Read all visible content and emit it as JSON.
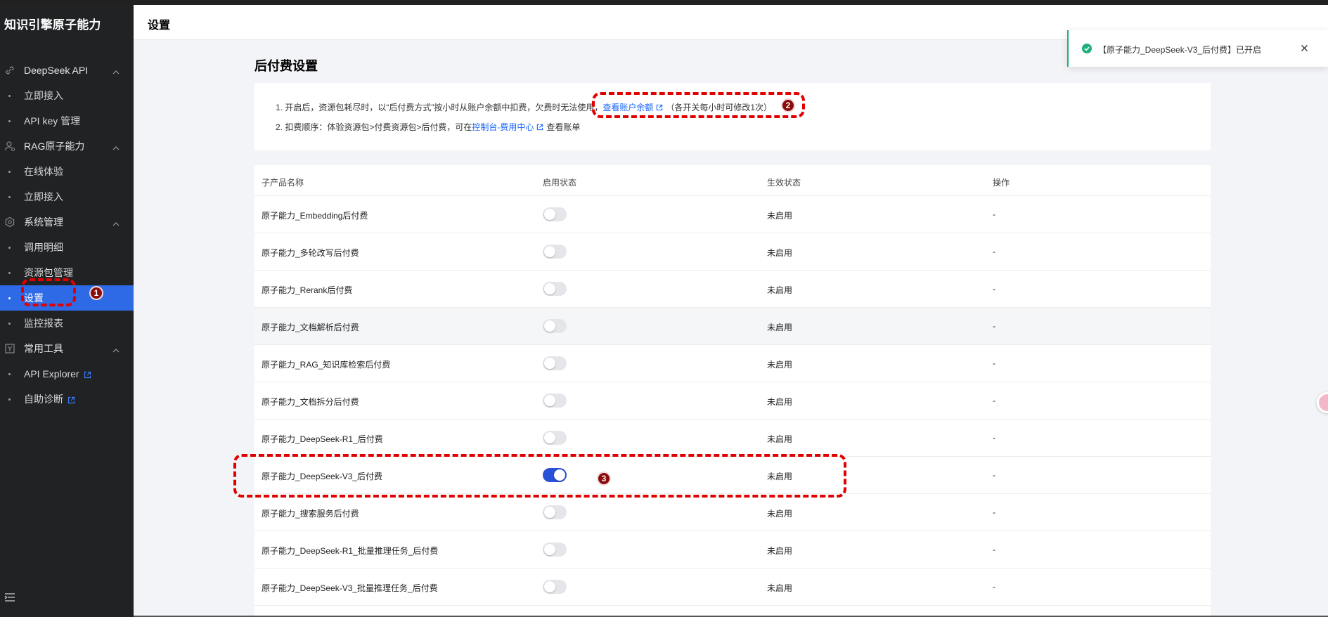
{
  "app": {
    "title": "知识引擎原子能力"
  },
  "sidebar": {
    "groups": [
      {
        "label": "DeepSeek API",
        "icon": "link-icon",
        "items": [
          {
            "label": "立即接入"
          },
          {
            "label": "API key 管理"
          }
        ]
      },
      {
        "label": "RAG原子能力",
        "icon": "user-gear-icon",
        "items": [
          {
            "label": "在线体验"
          },
          {
            "label": "立即接入"
          }
        ]
      },
      {
        "label": "系统管理",
        "icon": "settings-icon",
        "items": [
          {
            "label": "调用明细"
          },
          {
            "label": "资源包管理"
          },
          {
            "label": "设置",
            "active": true
          },
          {
            "label": "监控报表"
          }
        ]
      },
      {
        "label": "常用工具",
        "icon": "tools-icon",
        "items": [
          {
            "label": "API Explorer",
            "external": true
          },
          {
            "label": "自助诊断",
            "external": true
          }
        ]
      }
    ]
  },
  "header": {
    "title": "设置"
  },
  "section": {
    "title": "后付费设置"
  },
  "notice": {
    "line1_prefix": "1. 开启后，资源包耗尽时，以“后付费方式”按小时从账户余额中扣费，欠费时无法使用，",
    "line1_link": "查看账户余额",
    "line1_suffix": "（各开关每小时可修改1次）",
    "line2_prefix": "2. 扣费顺序：体验资源包>付费资源包>后付费，可在",
    "line2_link": "控制台-费用中心",
    "line2_suffix": "查看账单"
  },
  "table": {
    "headers": [
      "子产品名称",
      "启用状态",
      "生效状态",
      "操作"
    ],
    "rows": [
      {
        "name": "原子能力_Embedding后付费",
        "enabled": false,
        "effect": "未启用",
        "action": "-"
      },
      {
        "name": "原子能力_多轮改写后付费",
        "enabled": false,
        "effect": "未启用",
        "action": "-"
      },
      {
        "name": "原子能力_Rerank后付费",
        "enabled": false,
        "effect": "未启用",
        "action": "-"
      },
      {
        "name": "原子能力_文档解析后付费",
        "enabled": false,
        "effect": "未启用",
        "action": "-"
      },
      {
        "name": "原子能力_RAG_知识库检索后付费",
        "enabled": false,
        "effect": "未启用",
        "action": "-"
      },
      {
        "name": "原子能力_文档拆分后付费",
        "enabled": false,
        "effect": "未启用",
        "action": "-"
      },
      {
        "name": "原子能力_DeepSeek-R1_后付费",
        "enabled": false,
        "effect": "未启用",
        "action": "-"
      },
      {
        "name": "原子能力_DeepSeek-V3_后付费",
        "enabled": true,
        "effect": "未启用",
        "action": "-"
      },
      {
        "name": "原子能力_搜索服务后付费",
        "enabled": false,
        "effect": "未启用",
        "action": "-"
      },
      {
        "name": "原子能力_DeepSeek-R1_批量推理任务_后付费",
        "enabled": false,
        "effect": "未启用",
        "action": "-"
      },
      {
        "name": "原子能力_DeepSeek-V3_批量推理任务_后付费",
        "enabled": false,
        "effect": "未启用",
        "action": "-"
      }
    ]
  },
  "toast": {
    "message": "【原子能力_DeepSeek-V3_后付费】已开启"
  },
  "annotations": {
    "badge1": "1",
    "badge2": "2",
    "badge3": "3"
  },
  "colors": {
    "accent": "#2e6ae6",
    "toggle_on": "#2851d8",
    "link": "#1664ff",
    "success": "#1fb079",
    "annotation": "#e00000"
  }
}
